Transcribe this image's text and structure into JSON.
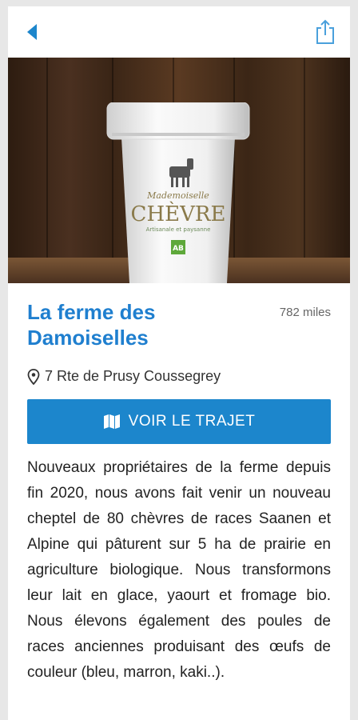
{
  "header": {
    "back_icon": "back-arrow-icon",
    "share_icon": "share-icon"
  },
  "hero": {
    "product_brand": "Mademoiselle",
    "product_name": "CHÈVRE",
    "product_tagline": "Artisanale et paysanne",
    "product_badge": "AB"
  },
  "farm": {
    "name": "La ferme des Damoiselles",
    "distance": "782 miles",
    "address": "7 Rte de Prusy Coussegrey",
    "description": "Nouveaux propriétaires de la ferme depuis fin 2020, nous avons fait venir un nouveau cheptel de 80 chèvres de races Saanen et Alpine qui pâturent sur 5 ha de prairie en agriculture biologique. Nous transformons leur lait en glace, yaourt et fromage bio. Nous élevons également des poules de races anciennes produisant des œufs de couleur (bleu, marron, kaki..)."
  },
  "actions": {
    "route_label": "VOIR LE TRAJET"
  },
  "colors": {
    "accent": "#1f7fcf",
    "button": "#1c86cc"
  }
}
